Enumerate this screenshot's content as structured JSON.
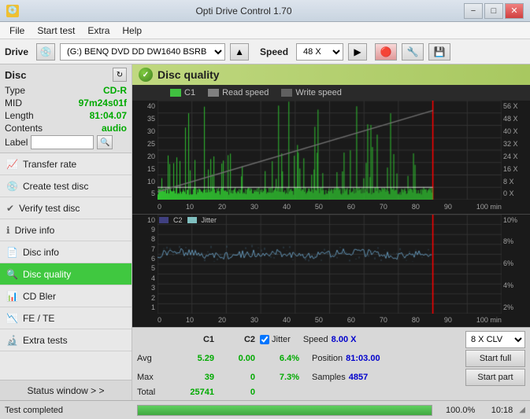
{
  "titleBar": {
    "icon": "💿",
    "title": "Opti Drive Control 1.70",
    "minimize": "−",
    "maximize": "□",
    "close": "✕"
  },
  "menuBar": {
    "items": [
      "File",
      "Start test",
      "Extra",
      "Help"
    ]
  },
  "driveBar": {
    "driveLabel": "Drive",
    "driveValue": "(G:)  BENQ DVD DD DW1640 BSRB",
    "speedLabel": "Speed",
    "speedValue": "48 X"
  },
  "disc": {
    "title": "Disc",
    "type": {
      "key": "Type",
      "val": "CD-R"
    },
    "mid": {
      "key": "MID",
      "val": "97m24s01f"
    },
    "length": {
      "key": "Length",
      "val": "81:04.07"
    },
    "contents": {
      "key": "Contents",
      "val": "audio"
    },
    "label": {
      "key": "Label",
      "val": ""
    },
    "labelPlaceholder": ""
  },
  "nav": {
    "items": [
      {
        "id": "transfer-rate",
        "label": "Transfer rate",
        "icon": "📈"
      },
      {
        "id": "create-test-disc",
        "label": "Create test disc",
        "icon": "💿"
      },
      {
        "id": "verify-test-disc",
        "label": "Verify test disc",
        "icon": "✔"
      },
      {
        "id": "drive-info",
        "label": "Drive info",
        "icon": "ℹ"
      },
      {
        "id": "disc-info",
        "label": "Disc info",
        "icon": "📄"
      },
      {
        "id": "disc-quality",
        "label": "Disc quality",
        "icon": "🔍",
        "active": true
      },
      {
        "id": "cd-bler",
        "label": "CD Bler",
        "icon": "📊"
      },
      {
        "id": "fe-te",
        "label": "FE / TE",
        "icon": "📉"
      },
      {
        "id": "extra-tests",
        "label": "Extra tests",
        "icon": "🔬"
      }
    ],
    "statusWindow": "Status window > >"
  },
  "chart": {
    "title": "Disc quality",
    "legend": {
      "c1": {
        "label": "C1",
        "color": "#40c040"
      },
      "readSpeed": {
        "label": "Read speed",
        "color": "#808080"
      },
      "writeSpeed": {
        "label": "Write speed",
        "color": "#606060"
      }
    },
    "upper": {
      "yLabels": [
        "35",
        "30",
        "25",
        "20",
        "15",
        "10",
        "5"
      ],
      "yRightLabels": [
        "56 X",
        "48 X",
        "40 X",
        "32 X",
        "24 X",
        "16 X",
        "8 X"
      ],
      "xLabels": [
        "0",
        "10",
        "20",
        "30",
        "40",
        "50",
        "60",
        "70",
        "80",
        "90",
        "100 min"
      ]
    },
    "lower": {
      "title": "C2",
      "jitterLabel": "Jitter",
      "yLabels": [
        "10",
        "9",
        "8",
        "7",
        "6",
        "5",
        "4",
        "3",
        "2",
        "1"
      ],
      "yRightLabels": [
        "10%",
        "8%",
        "6%",
        "4%",
        "2%"
      ],
      "xLabels": [
        "0",
        "10",
        "20",
        "30",
        "40",
        "50",
        "60",
        "70",
        "80",
        "90",
        "100 min"
      ]
    }
  },
  "stats": {
    "headers": [
      "C1",
      "C2"
    ],
    "rows": [
      {
        "label": "Avg",
        "c1": "5.29",
        "c2": "0.00",
        "jitter": "6.4%"
      },
      {
        "label": "Max",
        "c1": "39",
        "c2": "0",
        "jitter": "7.3%"
      },
      {
        "label": "Total",
        "c1": "25741",
        "c2": "0",
        "jitter": ""
      }
    ],
    "speed": {
      "label": "Speed",
      "value": "8.00 X"
    },
    "position": {
      "label": "Position",
      "value": "81:03.00"
    },
    "samples": {
      "label": "Samples",
      "value": "4857"
    },
    "jitterChecked": true,
    "jitterLabel": "Jitter",
    "speedSelector": "8 X CLV",
    "startFull": "Start full",
    "startPart": "Start part"
  },
  "statusBar": {
    "text": "Test completed",
    "progressPct": 100.0,
    "progressText": "100.0%",
    "time": "10:18"
  }
}
